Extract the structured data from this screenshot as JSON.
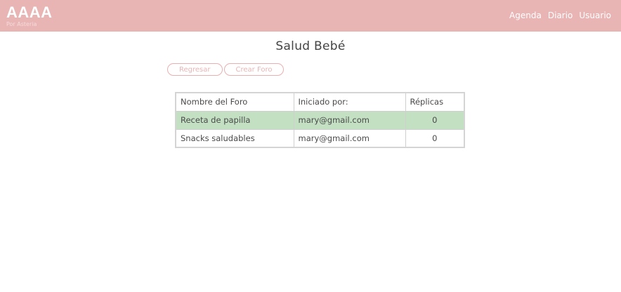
{
  "navbar": {
    "brand": "AAAA",
    "subtitle": "Por Asteria",
    "links": [
      "Agenda",
      "Diario",
      "Usuario"
    ],
    "background_color": "#e8b4b4"
  },
  "page": {
    "title": "Salud Bebé"
  },
  "buttons": {
    "back_label": "Regresar",
    "create_label": "Crear Foro"
  },
  "table": {
    "headers": [
      "Nombre del Foro",
      "Iniciado por:",
      "Réplicas"
    ],
    "rows": [
      {
        "name": "Receta de papilla",
        "started_by": "mary@gmail.com",
        "replies": "0",
        "highlighted": true
      },
      {
        "name": "Snacks saludables",
        "started_by": "mary@gmail.com",
        "replies": "0",
        "highlighted": false
      }
    ],
    "highlight_color": "#c3e0c3"
  }
}
